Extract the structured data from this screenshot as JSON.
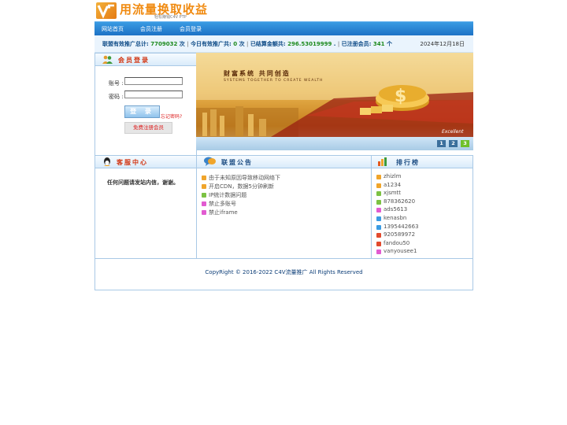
{
  "logo": {
    "title": "用流量换取收益",
    "subtitle": "轻松赚钱C4V PTP"
  },
  "nav": {
    "items": [
      "网站首页",
      "会员注册",
      "会员登录"
    ]
  },
  "stats": {
    "l1": "联盟有效推广总计:",
    "v1": "7709032",
    "u1": "次",
    "l2": "今日有效推广共:",
    "v2": "0",
    "u2": "次",
    "l3": "已结算金额共:",
    "v3": "296.53019999",
    "u3": ".",
    "l4": "已注册会员:",
    "v4": "341",
    "u4": "个",
    "sep": "|",
    "date": "2024年12月18日"
  },
  "login": {
    "title": "会员登录",
    "account_label": "账号 :",
    "password_label": "密码 :",
    "login_button": "登 录",
    "forgot": "忘记密码?",
    "register_button": "免费注册会员"
  },
  "banner": {
    "title": "财富系统 共同创造",
    "subtitle": "SYSTEMS TOGETHER TO CREATE WEALTH",
    "tag": "Excellent",
    "pages": [
      "1",
      "2",
      "3"
    ]
  },
  "service": {
    "title": "客服中心",
    "text": "任何问题请发站内信，谢谢。"
  },
  "notice": {
    "title": "联盟公告",
    "items": [
      "由于未知原因导致移动网络下",
      "开启CDN，数据5分钟刷新",
      "IP统计数据问题",
      "禁止多账号",
      "禁止iframe"
    ]
  },
  "rank": {
    "title": "排行榜",
    "items": [
      "zhizlm",
      "a1234",
      "xjsmtt",
      "878362620",
      "ads5613",
      "kenasbn",
      "1395442663",
      "920589972",
      "fandou50",
      "vanyousee1"
    ]
  },
  "footer": {
    "copyright": "CopyRight © 2016-2022 C4V流量推广 All Rights Reserved"
  },
  "colors": {
    "nav": "#1d72c6",
    "accent": "#f08a10",
    "green": "#1c8a1c",
    "border": "#a9c9e6"
  }
}
